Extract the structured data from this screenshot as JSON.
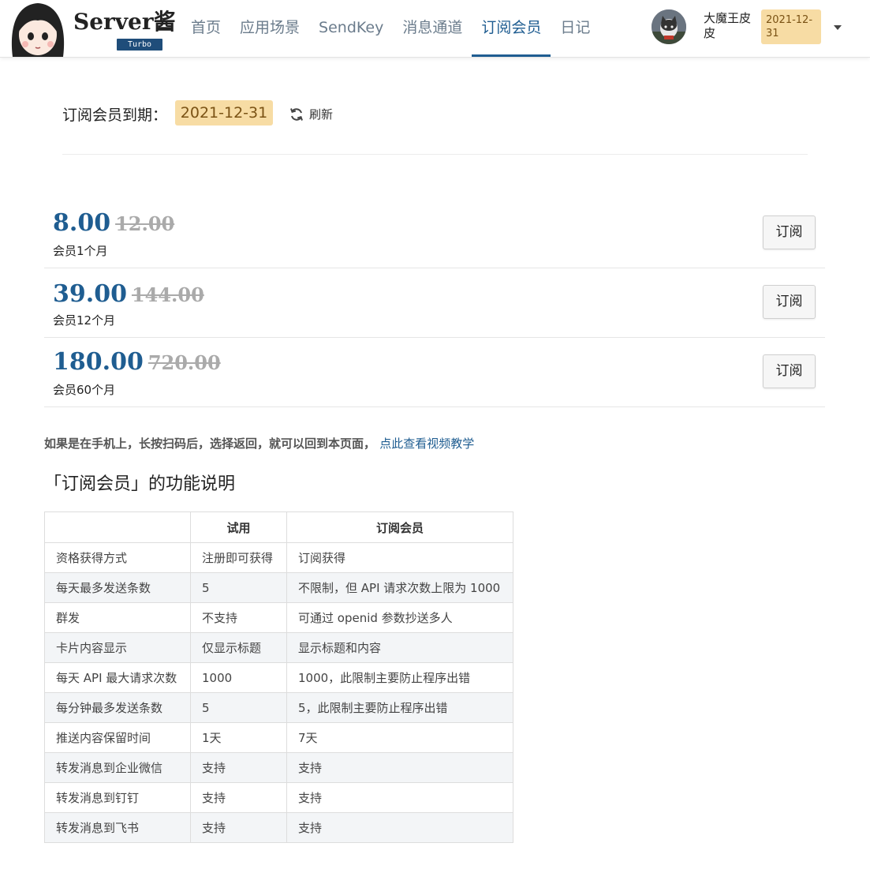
{
  "header": {
    "logo_text": "Server酱",
    "logo_badge": "Turbo",
    "nav": [
      {
        "label": "首页",
        "active": false
      },
      {
        "label": "应用场景",
        "active": false
      },
      {
        "label": "SendKey",
        "active": false
      },
      {
        "label": "消息通道",
        "active": false
      },
      {
        "label": "订阅会员",
        "active": true
      },
      {
        "label": "日记",
        "active": false
      }
    ],
    "user_name": "大魔王皮皮",
    "user_expiry": "2021-12-31"
  },
  "subscription": {
    "expiry_label": "订阅会员到期：",
    "expiry_date": "2021-12-31",
    "refresh_label": "刷新"
  },
  "plans": [
    {
      "price": "8.00",
      "original": "12.00",
      "desc": "会员1个月",
      "button": "订阅"
    },
    {
      "price": "39.00",
      "original": "144.00",
      "desc": "会员12个月",
      "button": "订阅"
    },
    {
      "price": "180.00",
      "original": "720.00",
      "desc": "会员60个月",
      "button": "订阅"
    }
  ],
  "hint": {
    "text": "如果是在手机上，长按扫码后，选择返回，就可以回到本页面，",
    "link": "点此查看视频教学"
  },
  "features": {
    "title": "「订阅会员」的功能说明",
    "headers": [
      "",
      "试用",
      "订阅会员"
    ],
    "rows": [
      [
        "资格获得方式",
        "注册即可获得",
        "订阅获得"
      ],
      [
        "每天最多发送条数",
        "5",
        "不限制，但 API 请求次数上限为 1000"
      ],
      [
        "群发",
        "不支持",
        "可通过 openid 参数抄送多人"
      ],
      [
        "卡片内容显示",
        "仅显示标题",
        "显示标题和内容"
      ],
      [
        "每天 API 最大请求次数",
        "1000",
        "1000，此限制主要防止程序出错"
      ],
      [
        "每分钟最多发送条数",
        "5",
        "5，此限制主要防止程序出错"
      ],
      [
        "推送内容保留时间",
        "1天",
        "7天"
      ],
      [
        "转发消息到企业微信",
        "支持",
        "支持"
      ],
      [
        "转发消息到钉钉",
        "支持",
        "支持"
      ],
      [
        "转发消息到飞书",
        "支持",
        "支持"
      ]
    ]
  },
  "colors": {
    "accent": "#1f5d91",
    "badge_bg": "#f7dca4",
    "badge_text": "#7a5214"
  }
}
